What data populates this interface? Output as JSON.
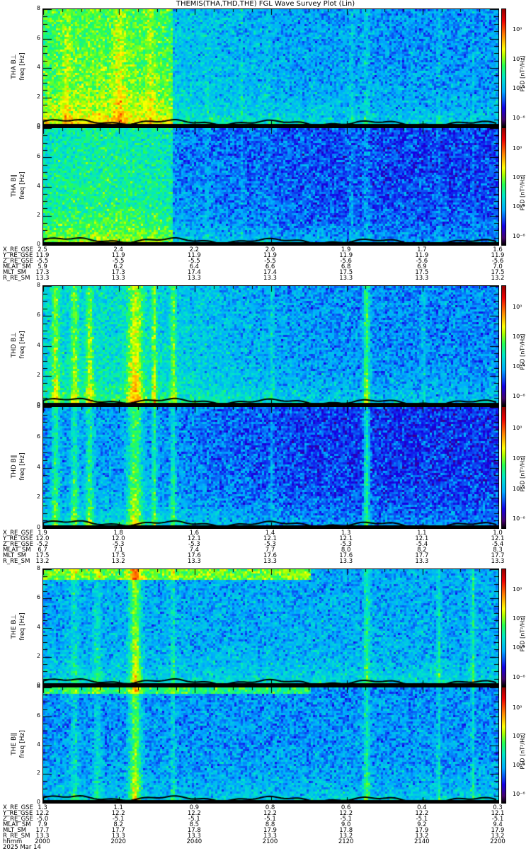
{
  "title": "THEMIS(THA,THD,THE) FGL Wave Survey Plot (Lin)",
  "chart_data": {
    "type": "heatmap",
    "title": "THEMIS(THA,THD,THE) FGL Wave Survey Plot (Lin)",
    "xlabel": "hhmm",
    "xlim_minutes_after_2000": [
      0,
      120
    ],
    "colorbar": {
      "label": "PSD [nT²/Hz]",
      "ticks": [
        "10⁰",
        "10⁻²",
        "10⁻⁴",
        "10⁻⁶"
      ],
      "tick_log_values": [
        0,
        -2,
        -4,
        -6
      ],
      "log_range": [
        -6.5,
        1.5
      ]
    },
    "panels": [
      {
        "label": "THA B⊥",
        "ylabel": "freq [Hz]",
        "ylim": [
          0,
          8
        ],
        "yticks": [
          "0",
          "2",
          "4",
          "6",
          "8"
        ],
        "base_log_psd": -4.2,
        "bursts": [
          [
            17,
            17,
            2.6
          ],
          [
            6,
            1,
            0.6
          ],
          [
            20,
            1.5,
            0.8
          ],
          [
            28,
            1,
            0.7
          ],
          [
            43,
            0.6,
            1.2
          ],
          [
            52,
            0.4,
            1.5
          ],
          [
            59,
            0.6,
            1.0
          ],
          [
            81,
            0.7,
            2.0
          ],
          [
            85,
            0.8,
            2.2
          ],
          [
            104,
            0.6,
            1.6
          ],
          [
            113,
            0.4,
            1.2
          ],
          [
            119,
            0.5,
            1.0
          ]
        ]
      },
      {
        "label": "THA B∥",
        "ylabel": "freq [Hz]",
        "ylim": [
          0,
          8
        ],
        "yticks": [
          "0",
          "2",
          "4",
          "6",
          "8"
        ],
        "base_log_psd": -4.8,
        "bursts": [
          [
            17,
            17,
            2.5
          ],
          [
            43,
            0.6,
            1.4
          ],
          [
            52,
            0.4,
            1.3
          ],
          [
            59,
            0.6,
            1.0
          ],
          [
            81,
            0.7,
            2.1
          ],
          [
            85,
            0.8,
            2.3
          ],
          [
            104,
            0.6,
            1.6
          ],
          [
            113,
            0.4,
            1.2
          ],
          [
            119,
            0.5,
            1.0
          ]
        ]
      },
      {
        "label": "THD B⊥",
        "ylabel": "freq [Hz]",
        "ylim": [
          0,
          8
        ],
        "yticks": [
          "0",
          "2",
          "4",
          "6",
          "8"
        ],
        "base_log_psd": -4.3,
        "bursts": [
          [
            3,
            1,
            1.8
          ],
          [
            8,
            1,
            1.6
          ],
          [
            12,
            1,
            1.7
          ],
          [
            24,
            2,
            2.4
          ],
          [
            29,
            0.6,
            2.0
          ],
          [
            34,
            0.7,
            1.7
          ],
          [
            16,
            15,
            1.2
          ],
          [
            85,
            0.8,
            2.3
          ],
          [
            60,
            0.5,
            0.8
          ],
          [
            100,
            0.5,
            0.7
          ]
        ]
      },
      {
        "label": "THD B∥",
        "ylabel": "freq [Hz]",
        "ylim": [
          0,
          8
        ],
        "yticks": [
          "0",
          "2",
          "4",
          "6",
          "8"
        ],
        "base_log_psd": -4.9,
        "bursts": [
          [
            3,
            1,
            1.8
          ],
          [
            8,
            1,
            1.6
          ],
          [
            12,
            1,
            1.7
          ],
          [
            24,
            2,
            2.2
          ],
          [
            29,
            0.6,
            1.9
          ],
          [
            34,
            0.7,
            1.5
          ],
          [
            16,
            15,
            1.0
          ],
          [
            85,
            0.8,
            2.3
          ],
          [
            60,
            0.5,
            0.7
          ]
        ]
      },
      {
        "label": "THE B⊥",
        "ylabel": "freq [Hz]",
        "ylim": [
          0,
          8
        ],
        "yticks": [
          "0",
          "2",
          "4",
          "6",
          "8"
        ],
        "base_log_psd": -4.0,
        "bursts": [
          [
            24,
            1.5,
            2.6
          ],
          [
            8,
            1,
            0.9
          ],
          [
            14,
            1,
            0.9
          ],
          [
            34,
            0.6,
            1.0
          ],
          [
            85,
            0.8,
            1.4
          ],
          [
            104,
            0.5,
            1.2
          ],
          [
            113,
            0.4,
            1.5
          ]
        ]
      },
      {
        "label": "THE B∥",
        "ylabel": "freq [Hz]",
        "ylim": [
          0,
          8
        ],
        "yticks": [
          "0",
          "2",
          "4",
          "6",
          "8"
        ],
        "base_log_psd": -4.2,
        "bursts": [
          [
            24,
            1.5,
            2.6
          ],
          [
            8,
            1,
            1.0
          ],
          [
            14,
            1,
            1.0
          ],
          [
            34,
            0.6,
            1.0
          ],
          [
            85,
            0.8,
            1.5
          ],
          [
            104,
            0.5,
            1.0
          ],
          [
            113,
            0.4,
            1.2
          ]
        ]
      }
    ]
  },
  "ephemeris": {
    "row_labels": [
      "X_RE_GSE",
      "Y_RE_GSE",
      "Z_RE_GSE",
      "MLAT_SM",
      "MLT_SM",
      "R_RE_SM"
    ],
    "sections": [
      {
        "rows": [
          [
            "2.5",
            "2.4",
            "2.2",
            "2.0",
            "1.9",
            "1.7",
            "1.6"
          ],
          [
            "11.9",
            "11.9",
            "11.9",
            "11.9",
            "11.9",
            "11.9",
            "11.9"
          ],
          [
            "-5.5",
            "-5.5",
            "-5.5",
            "-5.5",
            "-5.6",
            "-5.6",
            "-5.6"
          ],
          [
            "5.9",
            "6.2",
            "6.4",
            "6.6",
            "6.8",
            "6.9",
            "7.0"
          ],
          [
            "17.3",
            "17.3",
            "17.4",
            "17.4",
            "17.5",
            "17.5",
            "17.5"
          ],
          [
            "13.3",
            "13.3",
            "13.3",
            "13.3",
            "13.3",
            "13.3",
            "13.2"
          ]
        ]
      },
      {
        "rows": [
          [
            "1.9",
            "1.8",
            "1.6",
            "1.4",
            "1.3",
            "1.1",
            "1.0"
          ],
          [
            "12.0",
            "12.0",
            "12.1",
            "12.1",
            "12.1",
            "12.1",
            "12.1"
          ],
          [
            "-5.2",
            "-5.3",
            "-5.3",
            "-5.3",
            "-5.3",
            "-5.4",
            "-5.4"
          ],
          [
            "6.7",
            "7.1",
            "7.4",
            "7.7",
            "8.0",
            "8.2",
            "8.3"
          ],
          [
            "17.5",
            "17.5",
            "17.6",
            "17.6",
            "17.6",
            "17.7",
            "17.7"
          ],
          [
            "13.2",
            "13.2",
            "13.3",
            "13.3",
            "13.3",
            "13.3",
            "13.3"
          ]
        ]
      },
      {
        "rows": [
          [
            "1.3",
            "1.1",
            "0.9",
            "0.8",
            "0.6",
            "0.4",
            "0.3"
          ],
          [
            "12.2",
            "12.2",
            "12.2",
            "12.2",
            "12.2",
            "12.2",
            "12.1"
          ],
          [
            "-5.0",
            "-5.1",
            "-5.1",
            "-5.1",
            "-5.1",
            "-5.1",
            "-5.1"
          ],
          [
            "7.9",
            "8.2",
            "8.5",
            "8.8",
            "9.0",
            "9.2",
            "9.4"
          ],
          [
            "17.7",
            "17.7",
            "17.8",
            "17.9",
            "17.8",
            "17.9",
            "17.9"
          ],
          [
            "13.3",
            "13.3",
            "13.3",
            "13.3",
            "13.2",
            "13.2",
            "13.2"
          ]
        ]
      }
    ],
    "time_label": "hhmm",
    "times": [
      "2000",
      "2020",
      "2040",
      "2100",
      "2120",
      "2140",
      "2200"
    ],
    "date": "2025 Mar 14"
  }
}
